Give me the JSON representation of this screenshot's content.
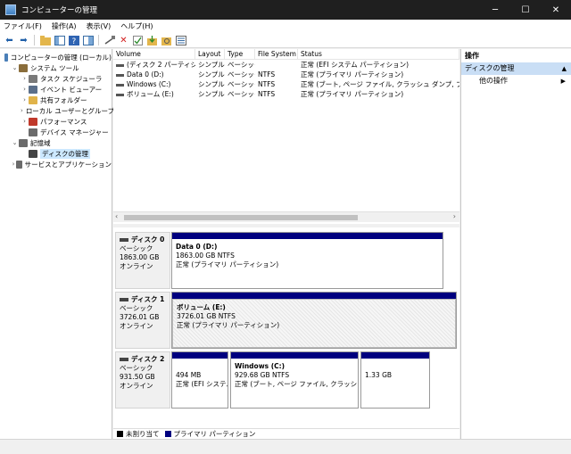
{
  "window": {
    "title": "コンピューターの管理",
    "min": "─",
    "max": "☐",
    "close": "✕"
  },
  "menu": [
    "ファイル(F)",
    "操作(A)",
    "表示(V)",
    "ヘルプ(H)"
  ],
  "tree": [
    {
      "label": "コンピューターの管理 (ローカル)",
      "indent": 0,
      "exp": "",
      "icon": "computer-icon",
      "color": "#4a7fb8"
    },
    {
      "label": "システム ツール",
      "indent": 1,
      "exp": "⌄",
      "icon": "tools-icon",
      "color": "#8a6d3b"
    },
    {
      "label": "タスク スケジューラ",
      "indent": 2,
      "exp": "›",
      "icon": "clock-icon",
      "color": "#7a7a7a"
    },
    {
      "label": "イベント ビューアー",
      "indent": 2,
      "exp": "›",
      "icon": "event-viewer-icon",
      "color": "#5b6f8a"
    },
    {
      "label": "共有フォルダー",
      "indent": 2,
      "exp": "›",
      "icon": "folder-icon",
      "color": "#e0b34a"
    },
    {
      "label": "ローカル ユーザーとグループ",
      "indent": 2,
      "exp": "›",
      "icon": "users-icon",
      "color": "#5a8ac9"
    },
    {
      "label": "パフォーマンス",
      "indent": 2,
      "exp": "›",
      "icon": "performance-icon",
      "color": "#c0392b"
    },
    {
      "label": "デバイス マネージャー",
      "indent": 2,
      "exp": "",
      "icon": "device-manager-icon",
      "color": "#6b6b6b"
    },
    {
      "label": "記憶域",
      "indent": 1,
      "exp": "⌄",
      "icon": "storage-icon",
      "color": "#6b6b6b"
    },
    {
      "label": "ディスクの管理",
      "indent": 2,
      "exp": "",
      "icon": "disk-management-icon",
      "color": "#444444",
      "selected": true
    },
    {
      "label": "サービスとアプリケーション",
      "indent": 1,
      "exp": "›",
      "icon": "services-icon",
      "color": "#6b6b6b"
    }
  ],
  "columns": [
    "Volume",
    "Layout",
    "Type",
    "File System",
    "Status"
  ],
  "volumes": [
    [
      "(ディスク 2 パーティション 1)",
      "シンプル",
      "ベーシック",
      "",
      "正常 (EFI システム パーティション)"
    ],
    [
      "Data 0 (D:)",
      "シンプル",
      "ベーシック",
      "NTFS",
      "正常 (プライマリ パーティション)"
    ],
    [
      "Windows (C:)",
      "シンプル",
      "ベーシック",
      "NTFS",
      "正常 (ブート, ページ ファイル, クラッシュ ダンプ, プライマリ パ"
    ],
    [
      "ボリューム (E:)",
      "シンプル",
      "ベーシック",
      "NTFS",
      "正常 (プライマリ パーティション)"
    ]
  ],
  "disks": [
    {
      "name": "ディスク 0",
      "type": "ベーシック",
      "size": "1863.00 GB",
      "state": "オンライン",
      "partitions": [
        {
          "name": "Data 0  (D:)",
          "size": "1863.00 GB NTFS",
          "status": "正常 (プライマリ パーティション)"
        }
      ]
    },
    {
      "name": "ディスク 1",
      "type": "ベーシック",
      "size": "3726.01 GB",
      "state": "オンライン",
      "partitions": [
        {
          "name": "ボリューム  (E:)",
          "size": "3726.01 GB NTFS",
          "status": "正常 (プライマリ パーティション)"
        }
      ]
    },
    {
      "name": "ディスク 2",
      "type": "ベーシック",
      "size": "931.50 GB",
      "state": "オンライン",
      "partitions": [
        {
          "name": "",
          "size": "494 MB",
          "status": "正常 (EFI システム"
        },
        {
          "name": "Windows  (C:)",
          "size": "929.68 GB NTFS",
          "status": "正常 (ブート, ページ ファイル, クラッシュ ダンプ, プ"
        },
        {
          "name": "",
          "size": "1.33 GB",
          "status": ""
        }
      ]
    }
  ],
  "legend": {
    "unallocated": "未割り当て",
    "primary": "プライマリ パーティション",
    "unallocated_color": "#000000",
    "primary_color": "#00007f"
  },
  "actions": {
    "title": "操作",
    "section": "ディスクの管理",
    "item": "他の操作"
  }
}
